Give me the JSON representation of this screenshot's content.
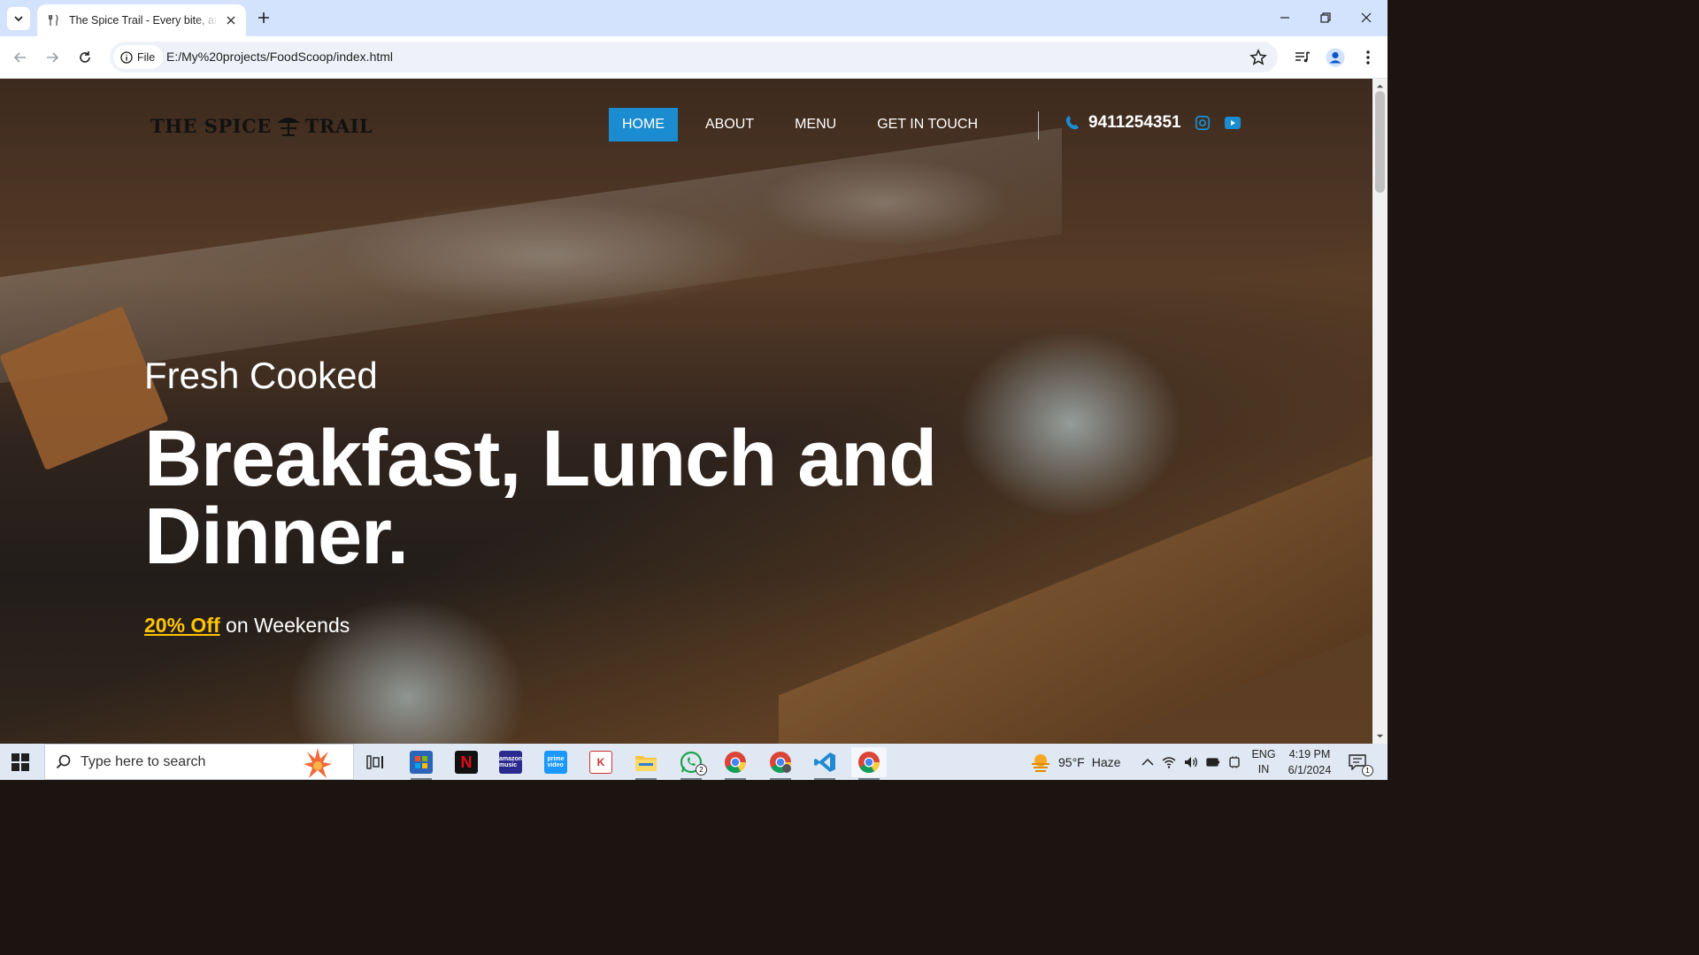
{
  "browser": {
    "tab_title": "The Spice Trail - Every bite, an a",
    "site_chip_label": "File",
    "url": "E:/My%20projects/FoodScoop/index.html"
  },
  "site": {
    "logo_text_left": "THE SPICE",
    "logo_text_right": "TRAIL",
    "nav": [
      {
        "label": "HOME",
        "active": true
      },
      {
        "label": "ABOUT",
        "active": false
      },
      {
        "label": "MENU",
        "active": false
      },
      {
        "label": "GET IN TOUCH",
        "active": false
      }
    ],
    "phone": "9411254351",
    "accent_color": "#1b8ccf",
    "offer_color": "#ffc400"
  },
  "hero": {
    "subtitle": "Fresh Cooked",
    "title": "Breakfast, Lunch and Dinner.",
    "offer_highlight": "20% Off",
    "offer_rest": " on Weekends"
  },
  "taskbar": {
    "search_placeholder": "Type here to search",
    "weather_temp": "95°F",
    "weather_desc": "Haze",
    "lang_line1": "ENG",
    "lang_line2": "IN",
    "time": "4:19 PM",
    "date": "6/1/2024",
    "whatsapp_badge": "2",
    "notification_count": "1",
    "apps": [
      "task-view",
      "microsoft-store",
      "netflix",
      "amazon-music",
      "prime-video",
      "app-tool",
      "file-explorer",
      "whatsapp",
      "chrome",
      "chrome-profile",
      "vscode",
      "chrome-active"
    ]
  }
}
